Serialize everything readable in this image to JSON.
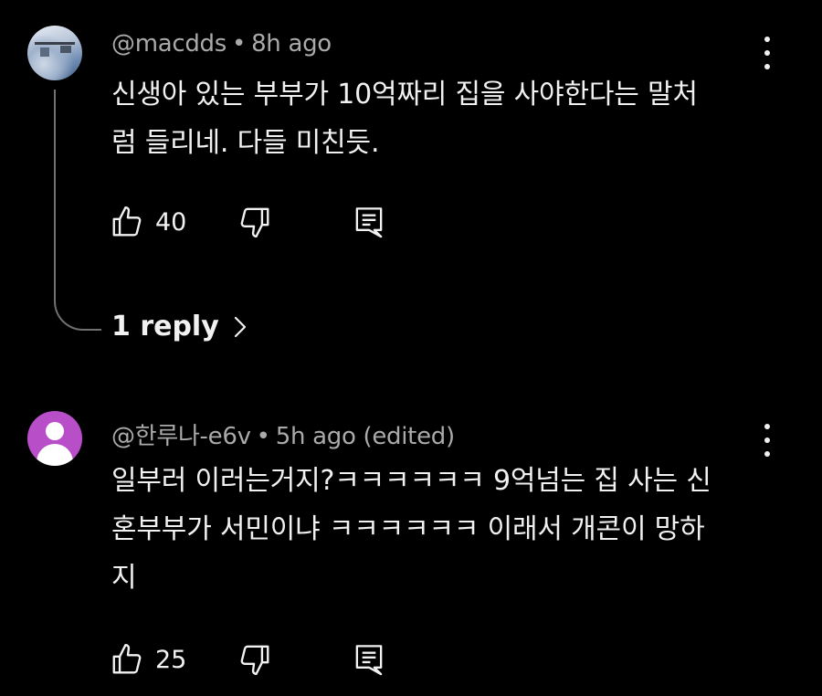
{
  "comments": [
    {
      "author": "@macdds",
      "time": "8h ago",
      "text_lines": [
        "신생아 있는 부부가 10억짜리 집을 사야한다는 말처",
        "럼 들리네. 다들 미친듯."
      ],
      "likes": "40",
      "replies_label": "1 reply",
      "avatar": "photo-avatar"
    },
    {
      "author": "@한루나-e6v",
      "time": "5h ago (edited)",
      "text_lines": [
        "일부러 이러는거지?ㅋㅋㅋㅋㅋㅋ 9억넘는 집 사는 신",
        "혼부부가 서민이냐 ㅋㅋㅋㅋㅋㅋ 이래서 개콘이 망하",
        "지"
      ],
      "likes": "25",
      "avatar": "default-person-avatar"
    }
  ],
  "icons": {
    "like": "thumbs-up-icon",
    "dislike": "thumbs-down-icon",
    "reply": "reply-comment-icon",
    "more": "more-vertical-icon",
    "chevron": "chevron-right-icon"
  },
  "colors": {
    "background": "#000000",
    "text": "#f1f1f1",
    "meta": "#aaaaaa",
    "avatar_default": "#b94fc8",
    "thread_line": "#717171"
  }
}
